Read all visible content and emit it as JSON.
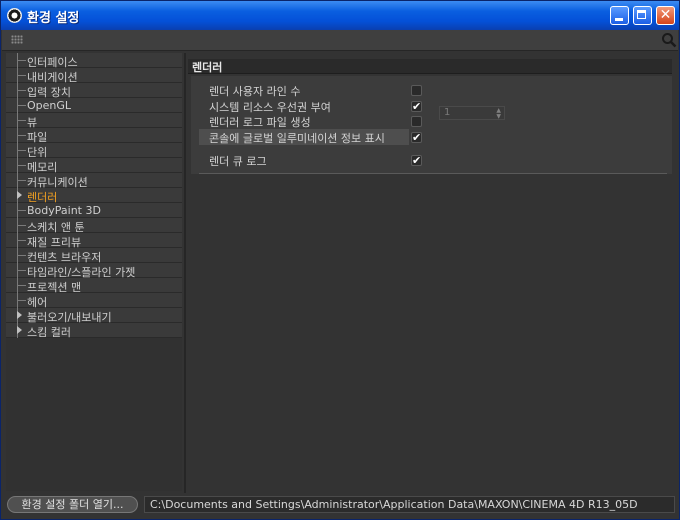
{
  "window": {
    "title": "환경 설정"
  },
  "sidebar": {
    "items": [
      {
        "label": "인터페이스",
        "expandable": false
      },
      {
        "label": "내비게이션",
        "expandable": false
      },
      {
        "label": "입력 장치",
        "expandable": false
      },
      {
        "label": "OpenGL",
        "expandable": false
      },
      {
        "label": "뷰",
        "expandable": false
      },
      {
        "label": "파일",
        "expandable": false
      },
      {
        "label": "단위",
        "expandable": false
      },
      {
        "label": "메모리",
        "expandable": false
      },
      {
        "label": "커뮤니케이션",
        "expandable": false
      },
      {
        "label": "렌더러",
        "expandable": true,
        "active": true
      },
      {
        "label": "BodyPaint 3D",
        "expandable": false
      },
      {
        "label": "스케치 앤 툰",
        "expandable": false
      },
      {
        "label": "재질 프리뷰",
        "expandable": false
      },
      {
        "label": "컨텐츠 브라우저",
        "expandable": false
      },
      {
        "label": "타임라인/스플라인 가젯",
        "expandable": false
      },
      {
        "label": "프로젝션 맨",
        "expandable": false
      },
      {
        "label": "헤어",
        "expandable": false
      },
      {
        "label": "불러오기/내보내기",
        "expandable": true
      },
      {
        "label": "스킴 컬러",
        "expandable": true
      }
    ],
    "active_color": "#f2a020"
  },
  "content": {
    "section_title": "렌더러",
    "options": [
      {
        "label": "렌더 사용자 라인 수",
        "checked": false
      },
      {
        "label": "시스템 리소스 우선권 부여",
        "checked": true
      },
      {
        "label": "렌더러 로그 파일 생성",
        "checked": false
      },
      {
        "label": "콘솔에 글로벌 일루미네이션 정보 표시",
        "checked": true,
        "highlighted": true
      },
      {
        "label": "렌더 큐 로그",
        "checked": true
      }
    ],
    "thread_count_value": "1",
    "checkmark": "✔"
  },
  "statusbar": {
    "folder_button_label": "환경 설정 폴더 열기...",
    "path": "C:\\Documents and Settings\\Administrator\\Application Data\\MAXON\\CINEMA 4D R13_05D"
  },
  "icons": {
    "app": "cinema4d-icon",
    "search": "search-icon",
    "grip": "grip-icon"
  }
}
